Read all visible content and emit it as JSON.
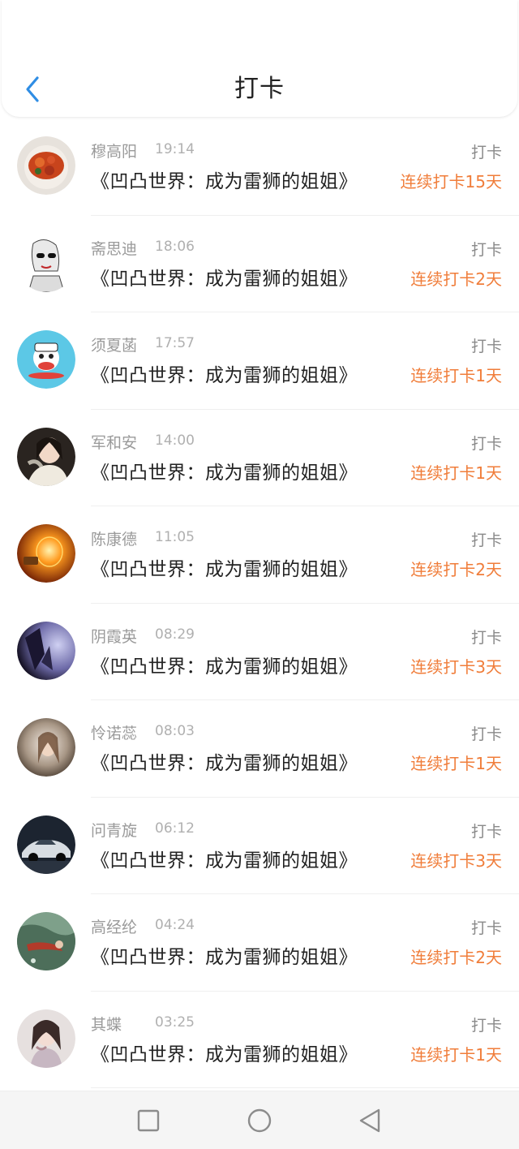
{
  "header": {
    "title": "打卡",
    "back_icon": "chevron-left-icon"
  },
  "list": [
    {
      "name": "穆高阳",
      "time": "19:14",
      "book": "《凹凸世界：成为雷狮的姐姐》",
      "action": "打卡",
      "streak": "连续打卡15天"
    },
    {
      "name": "斋思迪",
      "time": "18:06",
      "book": "《凹凸世界：成为雷狮的姐姐》",
      "action": "打卡",
      "streak": "连续打卡2天"
    },
    {
      "name": "须夏菡",
      "time": "17:57",
      "book": "《凹凸世界：成为雷狮的姐姐》",
      "action": "打卡",
      "streak": "连续打卡1天"
    },
    {
      "name": "军和安",
      "time": "14:00",
      "book": "《凹凸世界：成为雷狮的姐姐》",
      "action": "打卡",
      "streak": "连续打卡1天"
    },
    {
      "name": "陈康德",
      "time": "11:05",
      "book": "《凹凸世界：成为雷狮的姐姐》",
      "action": "打卡",
      "streak": "连续打卡2天"
    },
    {
      "name": "阴霞英",
      "time": "08:29",
      "book": "《凹凸世界：成为雷狮的姐姐》",
      "action": "打卡",
      "streak": "连续打卡3天"
    },
    {
      "name": "怜诺蕊",
      "time": "08:03",
      "book": "《凹凸世界：成为雷狮的姐姐》",
      "action": "打卡",
      "streak": "连续打卡1天"
    },
    {
      "name": "问青旋",
      "time": "06:12",
      "book": "《凹凸世界：成为雷狮的姐姐》",
      "action": "打卡",
      "streak": "连续打卡3天"
    },
    {
      "name": "高经纶",
      "time": "04:24",
      "book": "《凹凸世界：成为雷狮的姐姐》",
      "action": "打卡",
      "streak": "连续打卡2天"
    },
    {
      "name": "其蝶",
      "time": "03:25",
      "book": "《凹凸世界：成为雷狮的姐姐》",
      "action": "打卡",
      "streak": "连续打卡1天"
    }
  ],
  "navbar": {
    "icons": [
      "square-icon",
      "circle-icon",
      "triangle-back-icon"
    ]
  },
  "colors": {
    "accent": "#2f8de4",
    "streak": "#f07d3a",
    "muted": "#9a9a9a"
  }
}
